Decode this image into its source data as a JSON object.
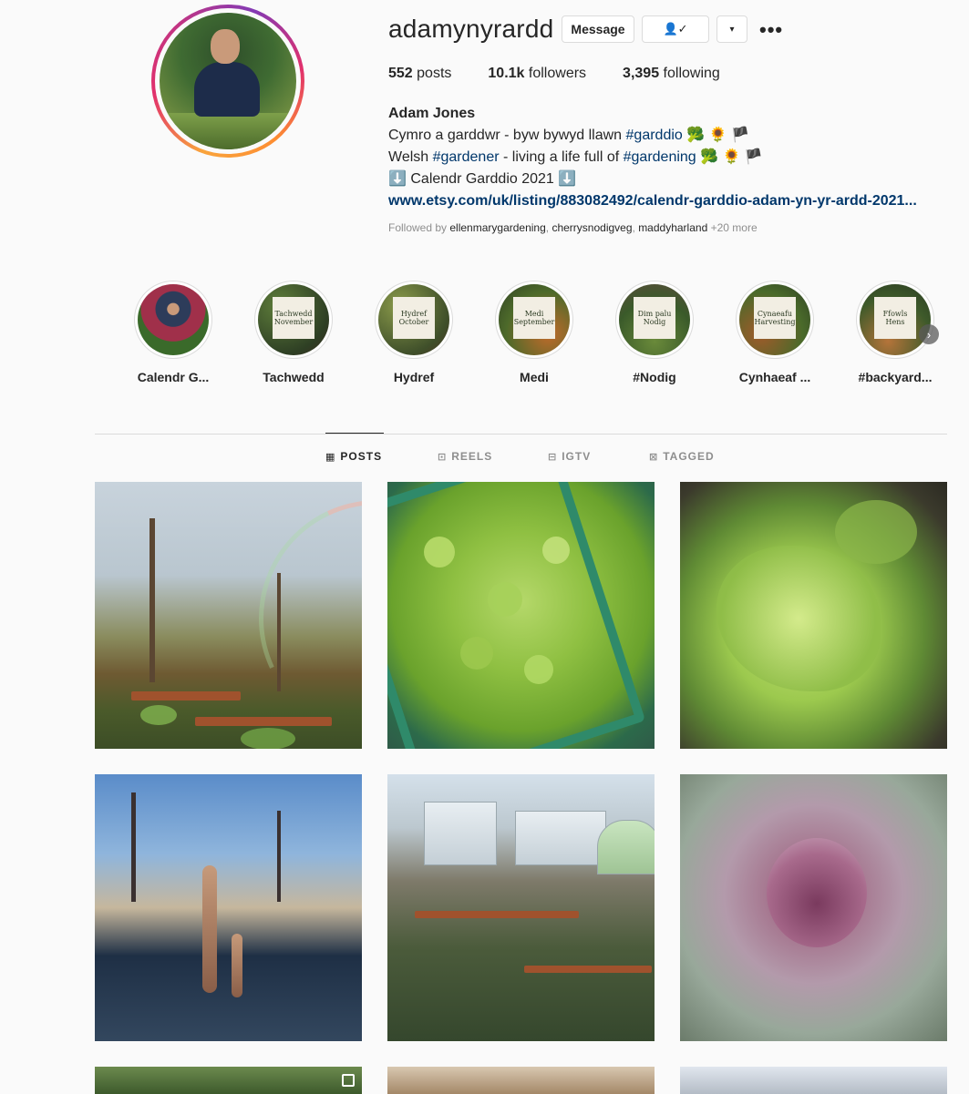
{
  "profile": {
    "username": "adamynyrardd",
    "message_label": "Message",
    "following_icon": "👤✓",
    "dropdown_icon": "▾",
    "more_icon": "•••",
    "posts_count": "552",
    "posts_label": "posts",
    "followers_count": "10.1k",
    "followers_label": "followers",
    "following_count": "3,395",
    "following_label": "following",
    "full_name": "Adam Jones",
    "bio_line1_text": "Cymro a garddwr - byw bywyd llawn ",
    "bio_line1_tag": "#garddio",
    "bio_line1_emoji": " 🥦 🌻 🏴",
    "bio_line2_prefix": "Welsh ",
    "bio_line2_tag1": "#gardener",
    "bio_line2_mid": " - living a life full of ",
    "bio_line2_tag2": "#gardening",
    "bio_line2_emoji": " 🥦 🌻 🏴",
    "bio_line3": "⬇️ Calendr Garddio 2021 ⬇️",
    "bio_link": "www.etsy.com/uk/listing/883082492/calendr-garddio-adam-yn-yr-ardd-2021...",
    "followed_by_label": "Followed by ",
    "followed_by_user1": "ellenmarygardening",
    "followed_by_user2": "cherrysnodigveg",
    "followed_by_user3": "maddyharland",
    "followed_by_more": "+20 more"
  },
  "highlights": [
    {
      "label": "Calendr G...",
      "card": ""
    },
    {
      "label": "Tachwedd",
      "card": "Tachwedd November"
    },
    {
      "label": "Hydref",
      "card": "Hydref October"
    },
    {
      "label": "Medi",
      "card": "Medi September"
    },
    {
      "label": "#Nodig",
      "card": "Dim palu Nodig"
    },
    {
      "label": "Cynhaeaf ...",
      "card": "Cynaeafu Harvesting"
    },
    {
      "label": "#backyard...",
      "card": "Ffowls Hens"
    }
  ],
  "highlights_next_icon": "›",
  "tabs": [
    {
      "label": "POSTS",
      "icon": "▦"
    },
    {
      "label": "REELS",
      "icon": "⊡"
    },
    {
      "label": "IGTV",
      "icon": "⊟"
    },
    {
      "label": "TAGGED",
      "icon": "⊠"
    }
  ],
  "colors": {
    "link": "#00376b",
    "text": "#262626",
    "muted": "#8e8e8e",
    "border": "#dbdbdb",
    "background": "#fafafa"
  }
}
